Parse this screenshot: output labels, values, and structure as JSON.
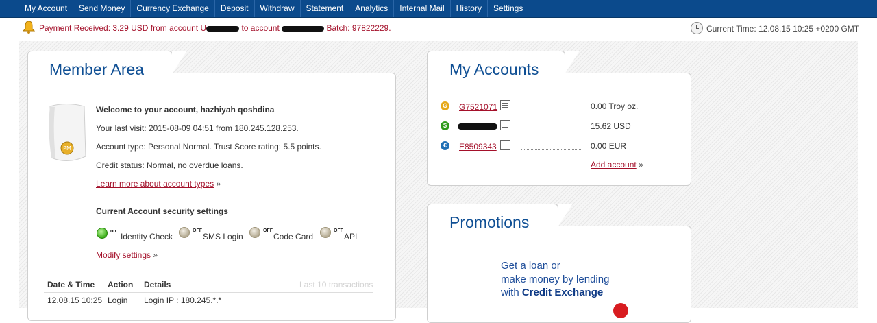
{
  "nav": {
    "items": [
      "My Account",
      "Send Money",
      "Currency Exchange",
      "Deposit",
      "Withdraw",
      "Statement",
      "Analytics",
      "Internal Mail",
      "History",
      "Settings"
    ]
  },
  "status": {
    "payment_prefix": "Payment Received: 3.29 USD from account U",
    "payment_mid": " to account ",
    "payment_suffix": " Batch: 97822229.",
    "current_time": "Current Time: 12.08.15 10:25 +0200 GMT"
  },
  "member": {
    "title": "Member Area",
    "badge": "PM",
    "welcome": "Welcome to your account, hazhiyah qoshdina",
    "last_visit": "Your last visit: 2015-08-09 04:51 from 180.245.128.253.",
    "account_type": "Account type: Personal Normal. Trust Score rating: 5.5 points.",
    "credit_status": "Credit status: Normal, no overdue loans.",
    "learn_more": "Learn more about account types",
    "raquo": "»",
    "security_title": "Current Account security settings",
    "security": [
      {
        "state": "on",
        "label": "Identity Check"
      },
      {
        "state": "OFF",
        "label": "SMS Login"
      },
      {
        "state": "OFF",
        "label": "Code Card"
      },
      {
        "state": "OFF",
        "label": "API"
      }
    ],
    "modify": "Modify settings",
    "table": {
      "headers": [
        "Date & Time",
        "Action",
        "Details"
      ],
      "last10": "Last 10 transactions",
      "rows": [
        [
          "12.08.15 10:25",
          "Login",
          "Login IP : 180.245.*.*"
        ]
      ]
    }
  },
  "accounts": {
    "title": "My Accounts",
    "items": [
      {
        "id": "G7521071",
        "balance": "0.00 Troy oz.",
        "color": "#e6a817",
        "symbol": "G"
      },
      {
        "id": "",
        "balance": "15.62 USD",
        "color": "#2f9a1a",
        "symbol": "$"
      },
      {
        "id": "E8509343",
        "balance": "0.00 EUR",
        "color": "#1f6fb5",
        "symbol": "€"
      }
    ],
    "add": "Add account",
    "raquo": "»"
  },
  "promotions": {
    "title": "Promotions",
    "line1": "Get a loan or",
    "line2": "make money by lending",
    "line3_prefix": "with ",
    "line3_bold": "Credit Exchange"
  }
}
